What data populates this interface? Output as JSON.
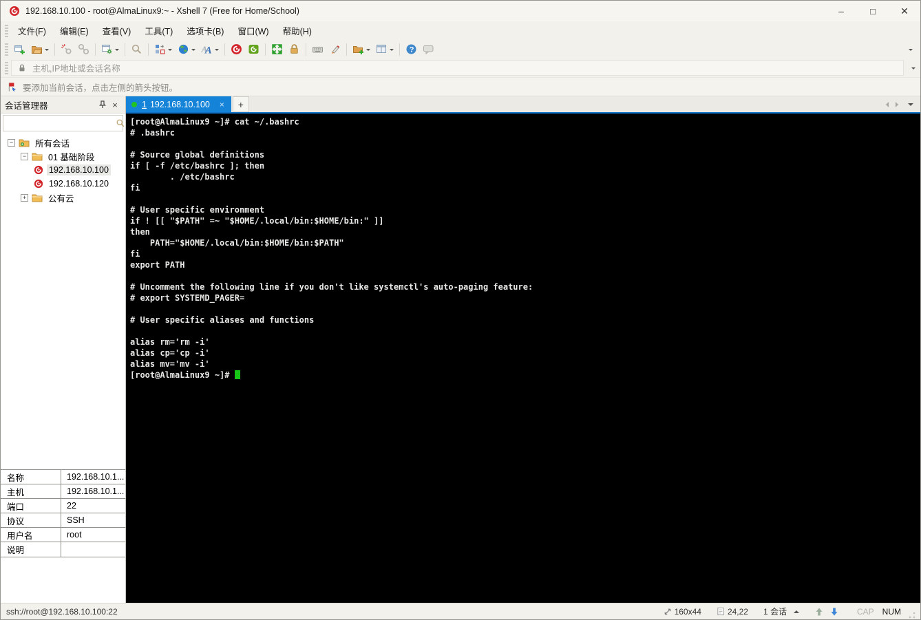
{
  "window": {
    "title": "192.168.10.100 - root@AlmaLinux9:~ - Xshell 7 (Free for Home/School)",
    "controls": {
      "minimize": "–",
      "maximize": "□",
      "close": "✕"
    }
  },
  "menu": {
    "items": [
      "文件(F)",
      "编辑(E)",
      "查看(V)",
      "工具(T)",
      "选项卡(B)",
      "窗口(W)",
      "帮助(H)"
    ]
  },
  "toolbar": {
    "icons": [
      "new-session",
      "open-session",
      "disconnect",
      "reconnect",
      "session-properties",
      "find",
      "arrange-layout",
      "web-browser",
      "font",
      "xshell",
      "xftp",
      "fullscreen",
      "lock-screen",
      "virtual-keyboard",
      "highlighter",
      "new-session-folder",
      "window-layout",
      "help",
      "feedback"
    ]
  },
  "address_bar": {
    "placeholder": "主机,IP地址或会话名称"
  },
  "info_bar": {
    "text": "要添加当前会话，点击左侧的箭头按钮。"
  },
  "session_manager": {
    "title": "会话管理器",
    "tree": [
      {
        "label": "所有会话",
        "level": 0,
        "icon": "folder-root",
        "expander": "minus",
        "selected": false
      },
      {
        "label": "01 基础阶段",
        "level": 1,
        "icon": "folder",
        "expander": "minus",
        "selected": false
      },
      {
        "label": "192.168.10.100",
        "level": 2,
        "icon": "session",
        "expander": "",
        "selected": true
      },
      {
        "label": "192.168.10.120",
        "level": 2,
        "icon": "session",
        "expander": "",
        "selected": false
      },
      {
        "label": "公有云",
        "level": 1,
        "icon": "folder",
        "expander": "plus",
        "selected": false
      }
    ],
    "properties": {
      "rows": [
        {
          "key": "名称",
          "value": "192.168.10.1..."
        },
        {
          "key": "主机",
          "value": "192.168.10.1..."
        },
        {
          "key": "端口",
          "value": "22"
        },
        {
          "key": "协议",
          "value": "SSH"
        },
        {
          "key": "用户名",
          "value": "root"
        },
        {
          "key": "说明",
          "value": ""
        }
      ]
    }
  },
  "tab_bar": {
    "active_tab": {
      "number": "1",
      "label": "192.168.10.100",
      "close": "×",
      "status_color": "#21c421"
    },
    "new_tab_label": "+"
  },
  "terminal": {
    "background": "#000000",
    "text_color": "#e8e8e6",
    "cursor_color": "#17c517",
    "lines": [
      "[root@AlmaLinux9 ~]# cat ~/.bashrc",
      "# .bashrc",
      "",
      "# Source global definitions",
      "if [ -f /etc/bashrc ]; then",
      "        . /etc/bashrc",
      "fi",
      "",
      "# User specific environment",
      "if ! [[ \"$PATH\" =~ \"$HOME/.local/bin:$HOME/bin:\" ]]",
      "then",
      "    PATH=\"$HOME/.local/bin:$HOME/bin:$PATH\"",
      "fi",
      "export PATH",
      "",
      "# Uncomment the following line if you don't like systemctl's auto-paging feature:",
      "# export SYSTEMD_PAGER=",
      "",
      "# User specific aliases and functions",
      "",
      "alias rm='rm -i'",
      "alias cp='cp -i'",
      "alias mv='mv -i'"
    ],
    "prompt": "[root@AlmaLinux9 ~]# "
  },
  "status_bar": {
    "connection": "ssh://root@192.168.10.100:22",
    "terminal_size": "160x44",
    "cursor_position": "24,22",
    "sessions": "1 会话",
    "caps_indicator": "CAP",
    "num_indicator": "NUM"
  }
}
